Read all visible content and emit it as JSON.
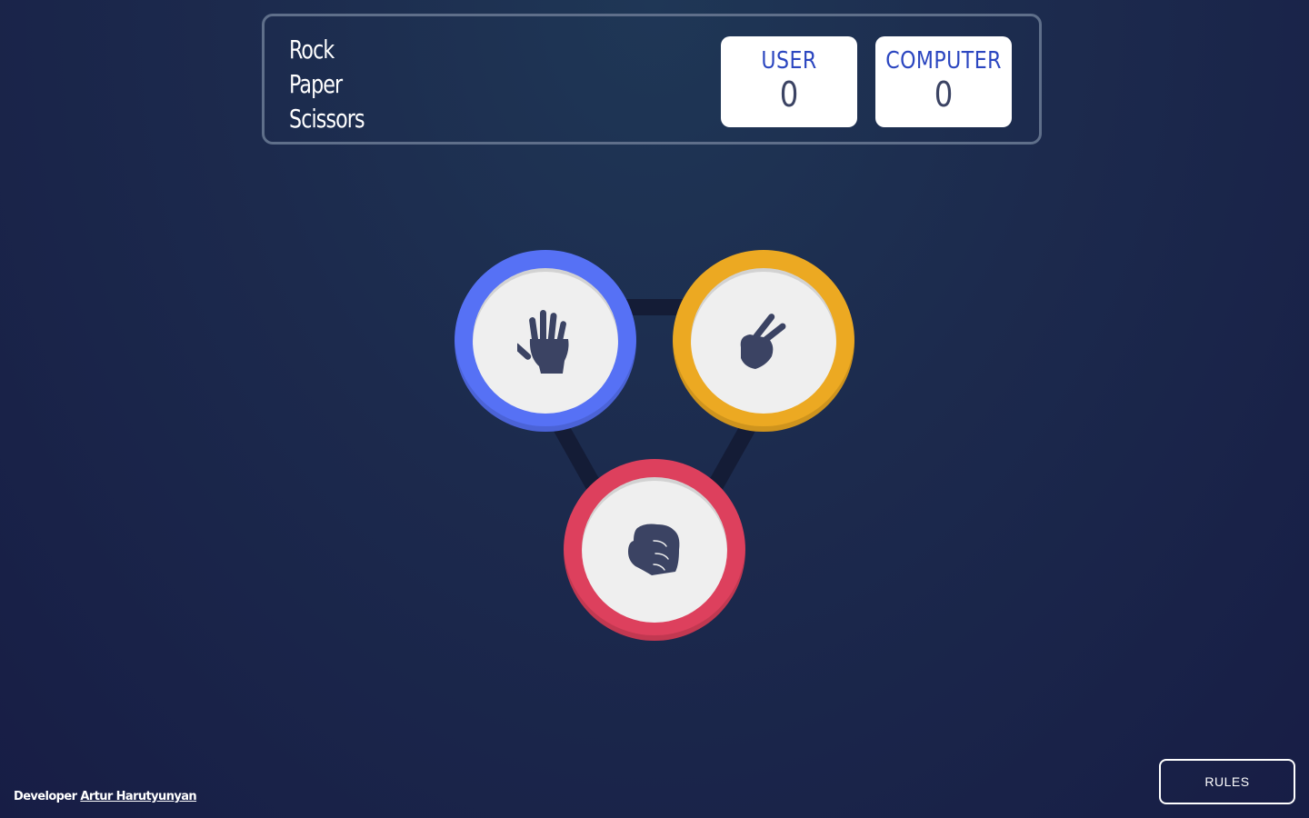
{
  "header": {
    "title_lines": [
      "Rock",
      "Paper",
      "Scissors"
    ],
    "user_score": {
      "label": "USER",
      "value": "0"
    },
    "computer_score": {
      "label": "COMPUTER",
      "value": "0"
    }
  },
  "choices": [
    {
      "id": "paper",
      "icon": "paper-hand-icon",
      "color": "#5671f5"
    },
    {
      "id": "scissors",
      "icon": "scissors-hand-icon",
      "color": "#eca922"
    },
    {
      "id": "rock",
      "icon": "rock-fist-icon",
      "color": "#dd405d"
    }
  ],
  "footer": {
    "prefix": "Developer",
    "developer_name": "Artur Harutyunyan"
  },
  "rules_button": {
    "label": "RULES"
  },
  "colors": {
    "background": "#1c2a4d",
    "score_label": "#2b46c0",
    "score_value": "#3b4363",
    "icon": "#3b4363"
  }
}
